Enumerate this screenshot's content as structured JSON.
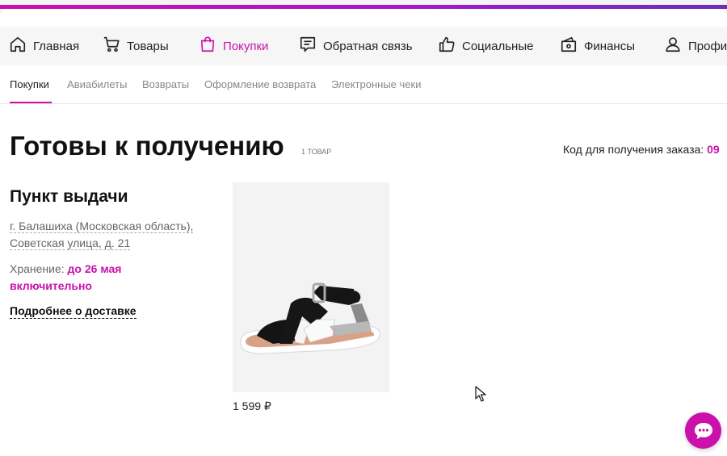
{
  "nav": {
    "items": [
      {
        "label": "Главная",
        "icon": "home-icon"
      },
      {
        "label": "Товары",
        "icon": "cart-icon"
      },
      {
        "label": "Покупки",
        "icon": "shopping-bag-icon",
        "active": true
      },
      {
        "label": "Обратная связь",
        "icon": "feedback-icon"
      },
      {
        "label": "Социальные",
        "icon": "thumbs-up-icon"
      },
      {
        "label": "Финансы",
        "icon": "wallet-icon"
      },
      {
        "label": "Профиль",
        "icon": "user-icon"
      }
    ]
  },
  "subnav": {
    "items": [
      "Покупки",
      "Авиабилеты",
      "Возвраты",
      "Оформление возврата",
      "Электронные чеки"
    ],
    "active": "Покупки"
  },
  "page": {
    "title": "Готовы к получению",
    "count": "1 товар",
    "pickup_code_label": "Код для получения заказа:",
    "pickup_code_value": "09"
  },
  "pickup_point": {
    "title": "Пункт выдачи",
    "address_line1": "г. Балашиха (Московская область),",
    "address_line2": "Советская улица, д. 21",
    "storage_label": "Хранение:",
    "storage_until": "до 26 мая",
    "storage_suffix": "включительно",
    "delivery_link": "Подробнее о доставке"
  },
  "product": {
    "price": "1 599 ₽",
    "image": "sandal-image"
  },
  "colors": {
    "accent": "#cb11ab",
    "gradient_end": "#6d2fb8"
  }
}
